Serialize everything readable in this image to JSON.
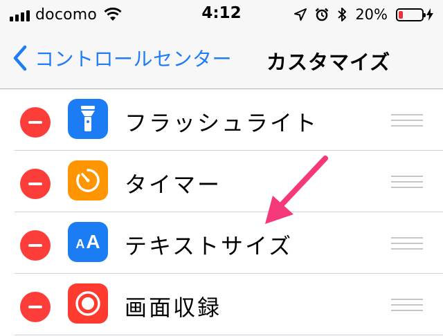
{
  "status_bar": {
    "carrier": "docomo",
    "time": "4:12",
    "battery_percent": "20%",
    "battery_level": 0.2,
    "icons": [
      "signal-icon",
      "wifi-icon",
      "location-icon",
      "alarm-icon",
      "bluetooth-icon",
      "battery-icon",
      "charging-icon"
    ]
  },
  "nav": {
    "back_label": "コントロールセンター",
    "title": "カスタマイズ"
  },
  "controls": [
    {
      "label": "フラッシュライト",
      "icon": "flashlight-icon",
      "icon_color": "#1c7cf4"
    },
    {
      "label": "タイマー",
      "icon": "timer-icon",
      "icon_color": "#ff9500"
    },
    {
      "label": "テキストサイズ",
      "icon": "text-size-icon",
      "icon_color": "#1c7cf4",
      "icon_text_small": "A",
      "icon_text_big": "A"
    },
    {
      "label": "画面収録",
      "icon": "screen-record-icon",
      "icon_color": "#ff3b30"
    }
  ],
  "colors": {
    "accent": "#1f7cf6",
    "delete": "#fc3d39",
    "annotation_arrow": "#f5387a"
  }
}
